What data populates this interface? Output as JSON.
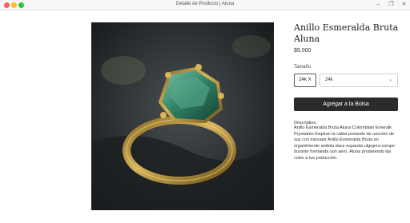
{
  "window": {
    "title": "Detalle de Producto | Aluna",
    "controls": [
      "minimize",
      "maximize",
      "close"
    ]
  },
  "product": {
    "title": "Anillo Esmeralda Bruta Aluna",
    "price": "$9.000",
    "size_label": "Tamaño",
    "selected_size": "24k X",
    "size_select_value": "24k",
    "add_to_bag": "Agregar a la Bolsa",
    "description_heading": "Description.",
    "description": "Anillo Esmeralda Bruta Aluna Colombiain Emeralk Prystatnte fnspiran la calda posando de uneción de sus con iniscator Anillo Esmeralda Bruta en organitmente ambita dace espanda ulgrgera compo durante formanda son aero. Aluna proderendo las coles a tus poducción."
  },
  "colors": {
    "button_bg": "#2b2b2b",
    "emerald": "#2f7f63",
    "gold": "#c9a24a",
    "stone_bg": "#2a2d2f"
  },
  "icons": {
    "photo": "emerald-ring-photo",
    "select_chevron": "chevron-down-icon"
  }
}
